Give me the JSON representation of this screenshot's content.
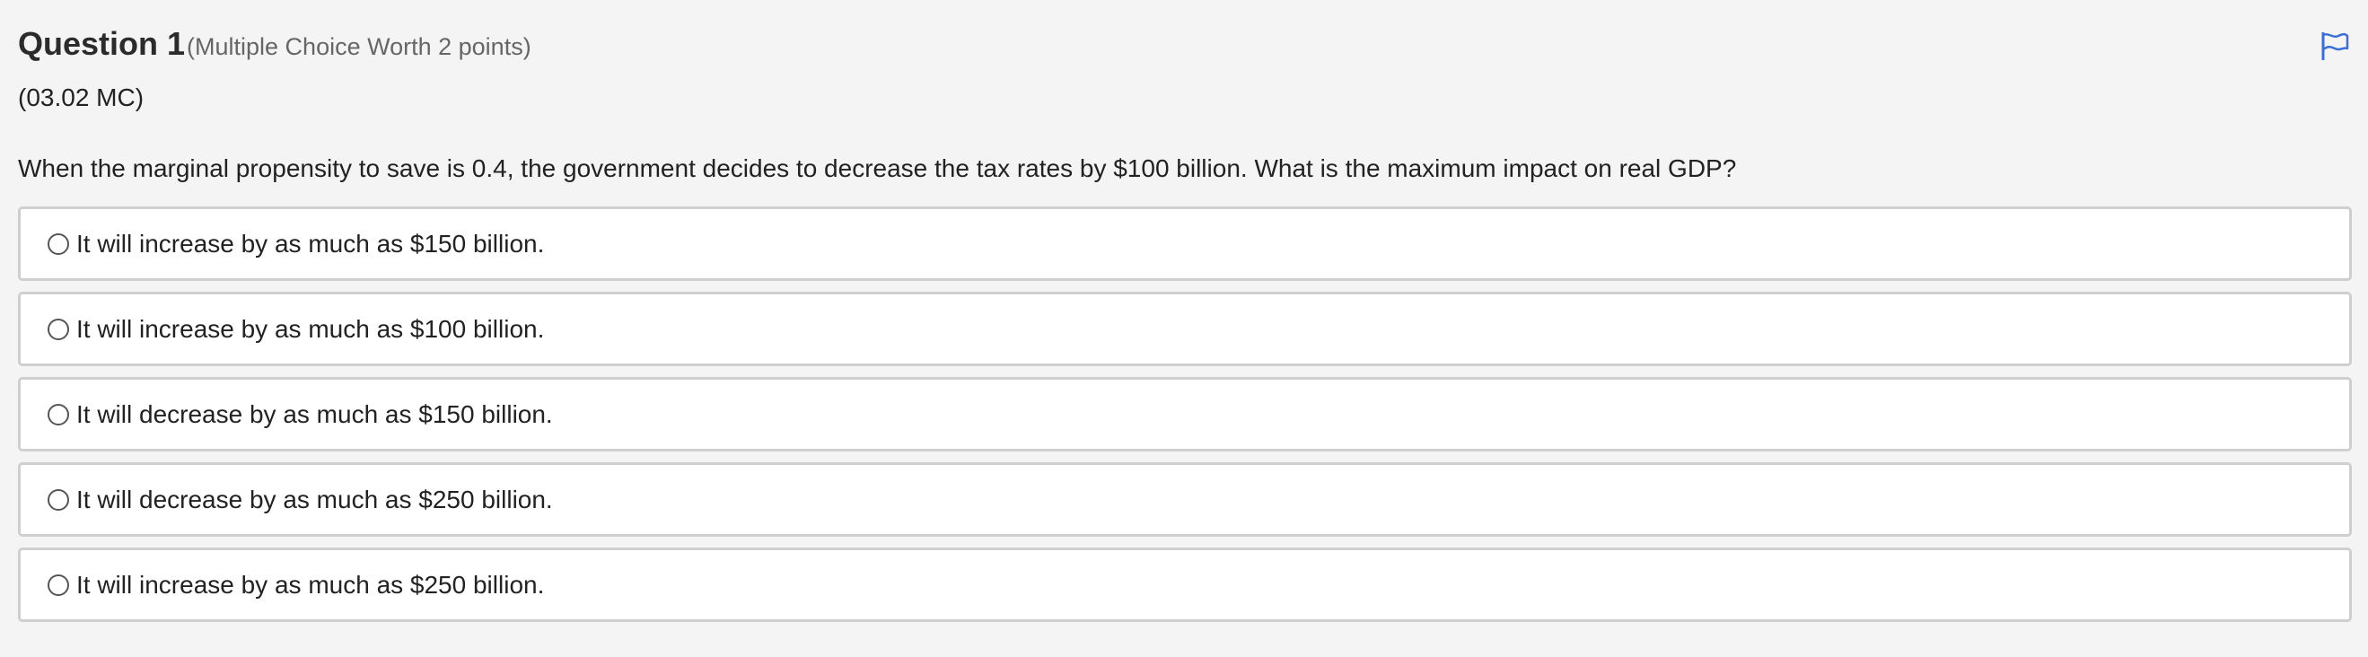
{
  "question": {
    "title": "Question 1",
    "meta": "(Multiple Choice Worth 2 points)",
    "code": "(03.02 MC)",
    "prompt": "When the marginal propensity to save is 0.4, the government decides to decrease the tax rates by $100 billion. What is the maximum impact on real GDP?",
    "flag_icon": "flag-icon",
    "options": [
      {
        "label": "It will increase by as much as $150 billion.",
        "selected": false
      },
      {
        "label": "It will increase by as much as $100 billion.",
        "selected": false
      },
      {
        "label": "It will decrease by as much as $150 billion.",
        "selected": false
      },
      {
        "label": "It will decrease by as much as $250 billion.",
        "selected": false
      },
      {
        "label": "It will increase by as much as $250 billion.",
        "selected": false
      }
    ]
  },
  "colors": {
    "background": "#f4f4f4",
    "option_border": "#cfcfcf",
    "flag_accent": "#3b6fd6"
  }
}
